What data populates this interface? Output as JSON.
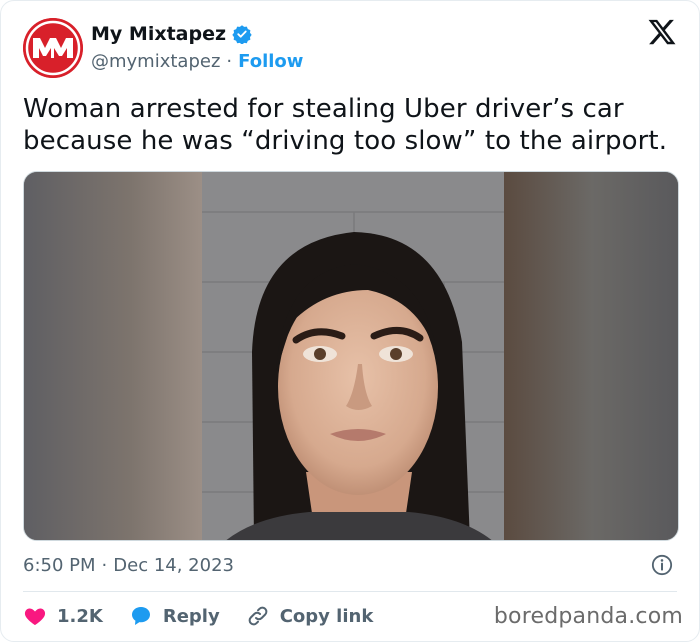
{
  "author": {
    "display_name": "My Mixtapez",
    "handle": "@mymixtapez",
    "separator": "·",
    "follow_label": "Follow",
    "avatar_text": "MM",
    "verified": true,
    "brand_color": "#d8202a"
  },
  "platform": {
    "logo_icon": "x-logo-icon"
  },
  "tweet": {
    "text": "Woman arrested for stealing Uber driver’s car\nbecause he was “driving too slow” to the airport.",
    "media_description": "mugshot-photo"
  },
  "meta": {
    "time": "6:50 PM",
    "separator": "·",
    "date": "Dec 14, 2023",
    "info_icon": "info-icon"
  },
  "actions": {
    "likes_count": "1.2K",
    "reply_label": "Reply",
    "copy_label": "Copy link"
  },
  "watermark": {
    "text": "boredpanda.com"
  },
  "colors": {
    "link": "#1d9bf0",
    "like": "#f91880",
    "secondary_text": "#536471",
    "primary_text": "#0f1419"
  }
}
